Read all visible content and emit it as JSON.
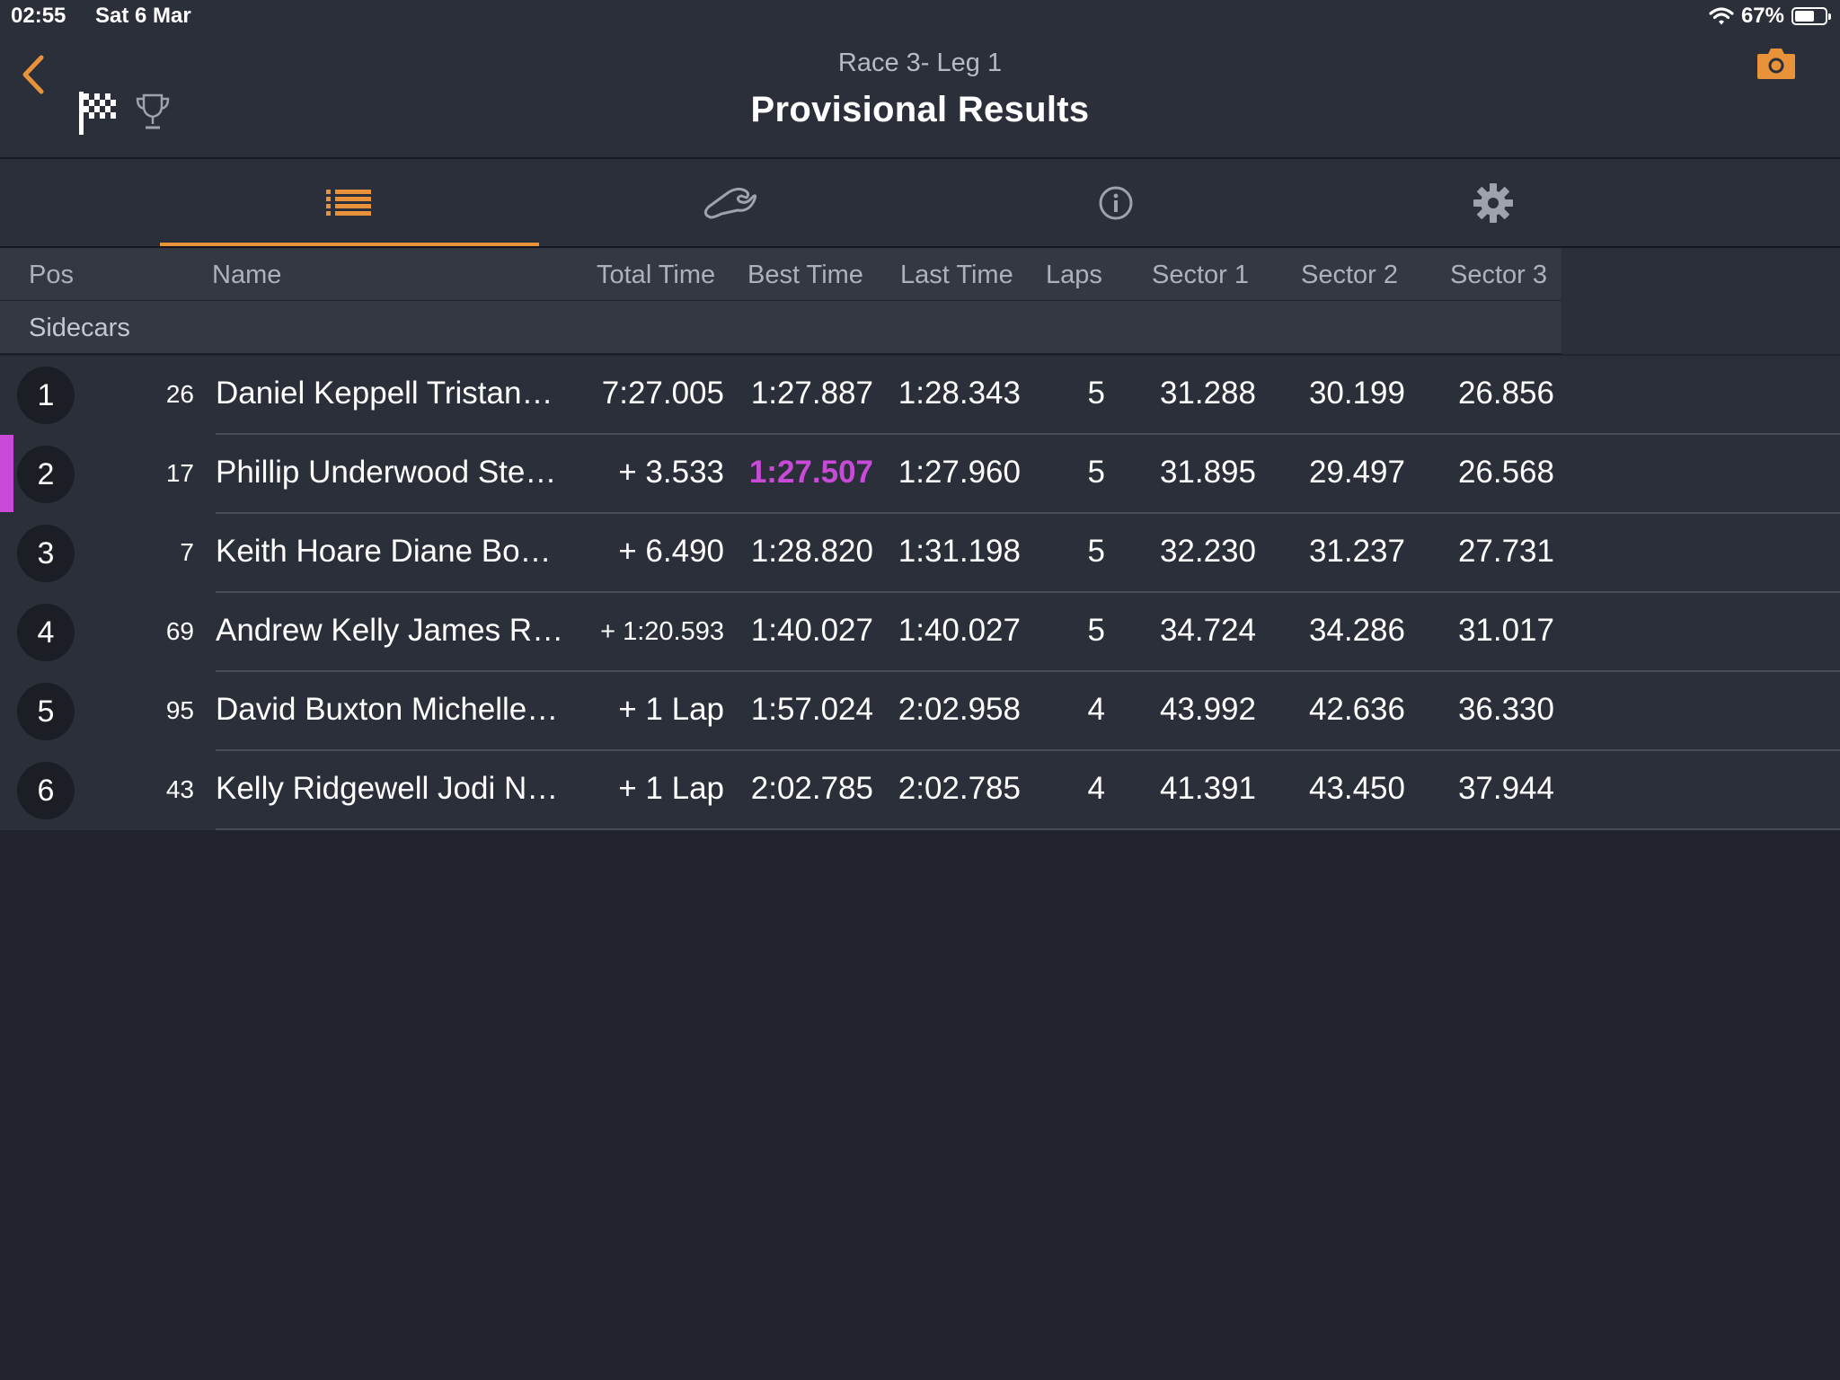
{
  "status": {
    "time": "02:55",
    "date": "Sat 6 Mar",
    "battery": "67%",
    "battery_level": 0.67
  },
  "header": {
    "subtitle": "Race 3-  Leg 1",
    "title": "Provisional Results"
  },
  "tabs": [
    {
      "icon": "list-icon",
      "active": true
    },
    {
      "icon": "track-icon",
      "active": false
    },
    {
      "icon": "info-icon",
      "active": false
    },
    {
      "icon": "gear-icon",
      "active": false
    }
  ],
  "columns": {
    "pos": "Pos",
    "name": "Name",
    "total": "Total Time",
    "best": "Best Time",
    "last": "Last Time",
    "laps": "Laps",
    "s1": "Sector 1",
    "s2": "Sector 2",
    "s3": "Sector 3"
  },
  "group": "Sidecars",
  "colors": {
    "accent": "#e8923a",
    "fastest": "#c84ad6"
  },
  "rows": [
    {
      "pos": "1",
      "num": "26",
      "name": "Daniel Keppell Tristan…",
      "total": "7:27.005",
      "best": "1:27.887",
      "last": "1:28.343",
      "laps": "5",
      "s1": "31.288",
      "s2": "30.199",
      "s3": "26.856"
    },
    {
      "pos": "2",
      "num": "17",
      "name": "Phillip Underwood Ste…",
      "total": "+ 3.533",
      "best": "1:27.507",
      "last": "1:27.960",
      "laps": "5",
      "s1": "31.895",
      "s2": "29.497",
      "s3": "26.568",
      "fastest": true
    },
    {
      "pos": "3",
      "num": "7",
      "name": "Keith Hoare Diane Bo…",
      "total": "+ 6.490",
      "best": "1:28.820",
      "last": "1:31.198",
      "laps": "5",
      "s1": "32.230",
      "s2": "31.237",
      "s3": "27.731"
    },
    {
      "pos": "4",
      "num": "69",
      "name": "Andrew Kelly James R…",
      "total": "+ 1:20.593",
      "best": "1:40.027",
      "last": "1:40.027",
      "laps": "5",
      "s1": "34.724",
      "s2": "34.286",
      "s3": "31.017"
    },
    {
      "pos": "5",
      "num": "95",
      "name": "David Buxton Michelle…",
      "total": "+ 1 Lap",
      "best": "1:57.024",
      "last": "2:02.958",
      "laps": "4",
      "s1": "43.992",
      "s2": "42.636",
      "s3": "36.330"
    },
    {
      "pos": "6",
      "num": "43",
      "name": "Kelly Ridgewell Jodi N…",
      "total": "+ 1 Lap",
      "best": "2:02.785",
      "last": "2:02.785",
      "laps": "4",
      "s1": "41.391",
      "s2": "43.450",
      "s3": "37.944"
    }
  ]
}
